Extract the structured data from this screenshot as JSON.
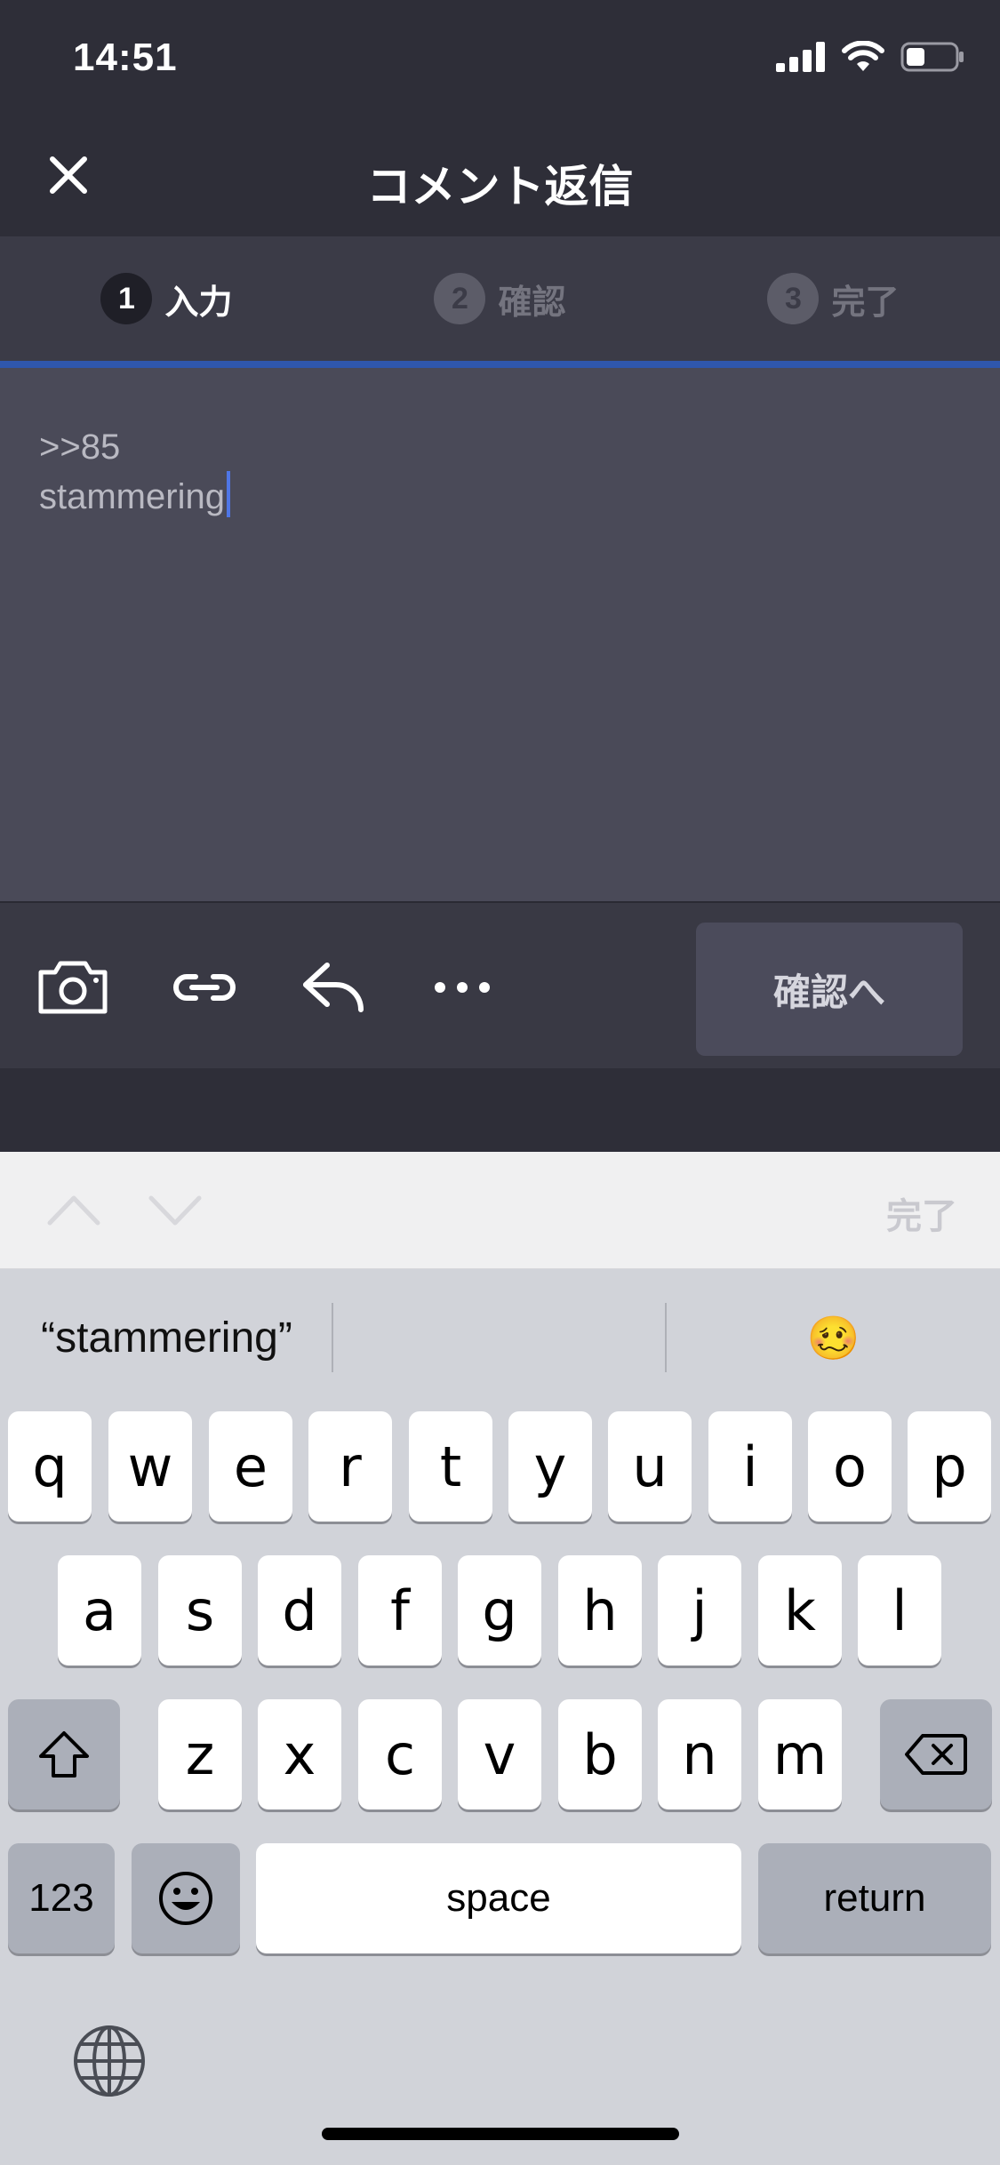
{
  "status": {
    "time": "14:51"
  },
  "nav": {
    "title": "コメント返信"
  },
  "steps": [
    {
      "num": "1",
      "label": "入力"
    },
    {
      "num": "2",
      "label": "確認"
    },
    {
      "num": "3",
      "label": "完了"
    }
  ],
  "editor": {
    "line1": ">>85",
    "line2": "stammering"
  },
  "toolbar": {
    "confirm_label": "確認へ"
  },
  "keyboard_accessory": {
    "done_label": "完了"
  },
  "suggestions": {
    "first": "“stammering”",
    "second": "",
    "third": "🥴"
  },
  "keys": {
    "row1": [
      "q",
      "w",
      "e",
      "r",
      "t",
      "y",
      "u",
      "i",
      "o",
      "p"
    ],
    "row2": [
      "a",
      "s",
      "d",
      "f",
      "g",
      "h",
      "j",
      "k",
      "l"
    ],
    "row3": [
      "z",
      "x",
      "c",
      "v",
      "b",
      "n",
      "m"
    ],
    "numbers": "123",
    "space": "space",
    "return": "return"
  },
  "colors": {
    "accent": "#2f57ad",
    "caret": "#4f76e6"
  }
}
